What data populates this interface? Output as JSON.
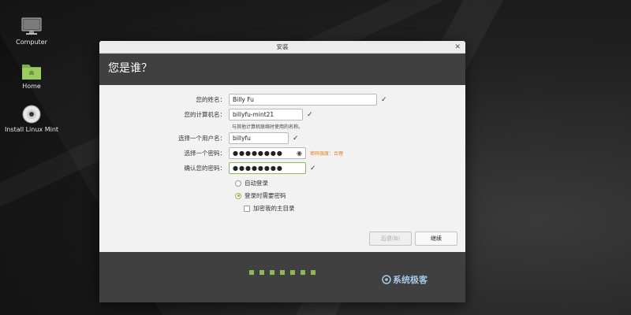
{
  "desktop": {
    "icons": [
      {
        "label": "Computer"
      },
      {
        "label": "Home"
      },
      {
        "label": "Install Linux Mint"
      }
    ]
  },
  "window": {
    "title": "安装",
    "heading": "您是谁？",
    "form": {
      "name_label": "您的姓名：",
      "name_value": "Billy Fu",
      "computer_label": "您的计算机名：",
      "computer_value": "billyfu-mint21",
      "computer_hint": "与其他计算机联络时使用的名称。",
      "username_label": "选择一个用户名：",
      "username_value": "billyfu",
      "password_label": "选择一个密码：",
      "password_value": "●●●●●●●●",
      "password_strength": "密码强度：合理",
      "confirm_label": "确认您的密码：",
      "confirm_value": "●●●●●●●●",
      "option_autologin": "自动登录",
      "option_require_password": "登录时需要密码",
      "option_encrypt_home": "加密我的主目录"
    },
    "buttons": {
      "back": "后退(B)",
      "next": "继续"
    },
    "footer": {
      "watermark": "系统极客"
    }
  },
  "colors": {
    "accent": "#8fb858",
    "header_bg": "#404040",
    "strength": "#e07f1c"
  }
}
